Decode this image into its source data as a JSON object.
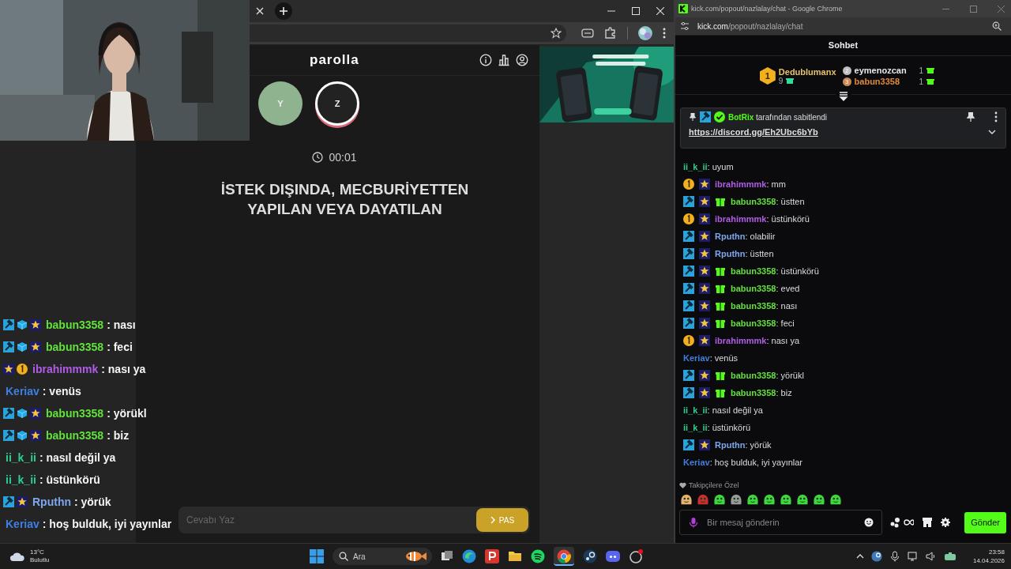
{
  "game_window": {
    "site_title": "parolla",
    "players": [
      {
        "initial": "Y",
        "selected": false
      },
      {
        "initial": "Z",
        "selected": true
      }
    ],
    "timer": "00:01",
    "question_lines": [
      "İSTEK DIŞINDA, MECBURİYETTEN",
      "YAPILAN VEYA DAYATILAN"
    ],
    "answer_placeholder": "Cevabı Yaz",
    "pass_button": "PAS"
  },
  "stream_chat_overlay": [
    {
      "name": "babun3358",
      "color": "#62e03c",
      "text": ": nası",
      "badges": [
        {
          "kind": "mod"
        },
        {
          "kind": "cube"
        },
        {
          "kind": "sub"
        }
      ]
    },
    {
      "name": "babun3358",
      "color": "#62e03c",
      "text": ": feci",
      "badges": [
        {
          "kind": "mod"
        },
        {
          "kind": "cube"
        },
        {
          "kind": "sub"
        }
      ]
    },
    {
      "name": "ibrahimmmk",
      "color": "#b05ce8",
      "text": ": nası ya",
      "badges": [
        {
          "kind": "sub"
        },
        {
          "kind": "og"
        }
      ]
    },
    {
      "name": "Keriav",
      "color": "#3f7fe0",
      "text": ": venüs"
    },
    {
      "name": "babun3358",
      "color": "#62e03c",
      "text": ": yörükl",
      "badges": [
        {
          "kind": "mod"
        },
        {
          "kind": "cube"
        },
        {
          "kind": "sub"
        }
      ]
    },
    {
      "name": "babun3358",
      "color": "#62e03c",
      "text": ": biz",
      "badges": [
        {
          "kind": "mod"
        },
        {
          "kind": "cube"
        },
        {
          "kind": "sub"
        }
      ]
    },
    {
      "name": "ii_k_ii",
      "color": "#2fcf8f",
      "text": ": nasıl değil ya"
    },
    {
      "name": "ii_k_ii",
      "color": "#2fcf8f",
      "text": ": üstünkörü"
    },
    {
      "name": "Rputhn",
      "color": "#7ea6ee",
      "text": ": yörük",
      "badges": [
        {
          "kind": "mod"
        },
        {
          "kind": "sub"
        }
      ]
    },
    {
      "name": "Keriav",
      "color": "#3f7fe0",
      "text": ": hoş bulduk, iyi yayınlar"
    }
  ],
  "chat_window": {
    "title": "kick.com/popout/nazlalay/chat - Google Chrome",
    "url_domain": "kick.com",
    "url_path": "/popout/nazlalay/chat",
    "heading": "Sohbet",
    "leaderboard": [
      {
        "rank": "1",
        "name": "Dedublumanx",
        "gifts": "9",
        "color": "#e8c36a"
      },
      {
        "rank": "2",
        "name": "eymenozcan",
        "gifts": "1",
        "color": "#e8e8e8"
      },
      {
        "rank": "3",
        "name": "babun3358",
        "gifts": "1",
        "color": "#e0893a"
      }
    ],
    "pinned": {
      "author": "BotRix",
      "note": "tarafından sabitlendi",
      "link": "https://discord.gg/Eh2Ubc6bYb"
    },
    "messages": [
      {
        "name": "ii_k_ii",
        "color": "#2fcf8f",
        "text": ": uyum"
      },
      {
        "name": "ibrahimmmk",
        "color": "#b05ce8",
        "text": ": mm",
        "badges": [
          {
            "kind": "og"
          },
          {
            "kind": "sub"
          }
        ]
      },
      {
        "name": "babun3358",
        "color": "#62e03c",
        "text": ": üstten",
        "badges": [
          {
            "kind": "mod"
          },
          {
            "kind": "sub"
          },
          {
            "kind": "gift"
          }
        ]
      },
      {
        "name": "ibrahimmmk",
        "color": "#b05ce8",
        "text": ": üstünkörü",
        "badges": [
          {
            "kind": "og"
          },
          {
            "kind": "sub"
          }
        ]
      },
      {
        "name": "Rputhn",
        "color": "#7ea6ee",
        "text": ": olabilir",
        "badges": [
          {
            "kind": "mod"
          },
          {
            "kind": "sub"
          }
        ]
      },
      {
        "name": "Rputhn",
        "color": "#7ea6ee",
        "text": ": üstten",
        "badges": [
          {
            "kind": "mod"
          },
          {
            "kind": "sub"
          }
        ]
      },
      {
        "name": "babun3358",
        "color": "#62e03c",
        "text": ": üstünkörü",
        "badges": [
          {
            "kind": "mod"
          },
          {
            "kind": "sub"
          },
          {
            "kind": "gift"
          }
        ]
      },
      {
        "name": "babun3358",
        "color": "#62e03c",
        "text": ": eved",
        "badges": [
          {
            "kind": "mod"
          },
          {
            "kind": "sub"
          },
          {
            "kind": "gift"
          }
        ]
      },
      {
        "name": "babun3358",
        "color": "#62e03c",
        "text": ": nası",
        "badges": [
          {
            "kind": "mod"
          },
          {
            "kind": "sub"
          },
          {
            "kind": "gift"
          }
        ]
      },
      {
        "name": "babun3358",
        "color": "#62e03c",
        "text": ": feci",
        "badges": [
          {
            "kind": "mod"
          },
          {
            "kind": "sub"
          },
          {
            "kind": "gift"
          }
        ]
      },
      {
        "name": "ibrahimmmk",
        "color": "#b05ce8",
        "text": ": nası ya",
        "badges": [
          {
            "kind": "og"
          },
          {
            "kind": "sub"
          }
        ]
      },
      {
        "name": "Keriav",
        "color": "#3f7fe0",
        "text": ": venüs"
      },
      {
        "name": "babun3358",
        "color": "#62e03c",
        "text": ": yörükl",
        "badges": [
          {
            "kind": "mod"
          },
          {
            "kind": "sub"
          },
          {
            "kind": "gift"
          }
        ]
      },
      {
        "name": "babun3358",
        "color": "#62e03c",
        "text": ": biz",
        "badges": [
          {
            "kind": "mod"
          },
          {
            "kind": "sub"
          },
          {
            "kind": "gift"
          }
        ]
      },
      {
        "name": "ii_k_ii",
        "color": "#2fcf8f",
        "text": ": nasıl değil ya"
      },
      {
        "name": "ii_k_ii",
        "color": "#2fcf8f",
        "text": ": üstünkörü"
      },
      {
        "name": "Rputhn",
        "color": "#7ea6ee",
        "text": ": yörük",
        "badges": [
          {
            "kind": "mod"
          },
          {
            "kind": "sub"
          }
        ]
      },
      {
        "name": "Keriav",
        "color": "#3f7fe0",
        "text": ": hoş bulduk, iyi yayınlar"
      }
    ],
    "emote_section": "Takipçilere Özel",
    "input_placeholder": "Bir mesaj gönderin",
    "send_button": "Gönder"
  },
  "taskbar": {
    "temperature": "13°C",
    "weather": "Bulutlu",
    "search": "Ara",
    "time": "23:58",
    "date": "14.04.2026"
  }
}
